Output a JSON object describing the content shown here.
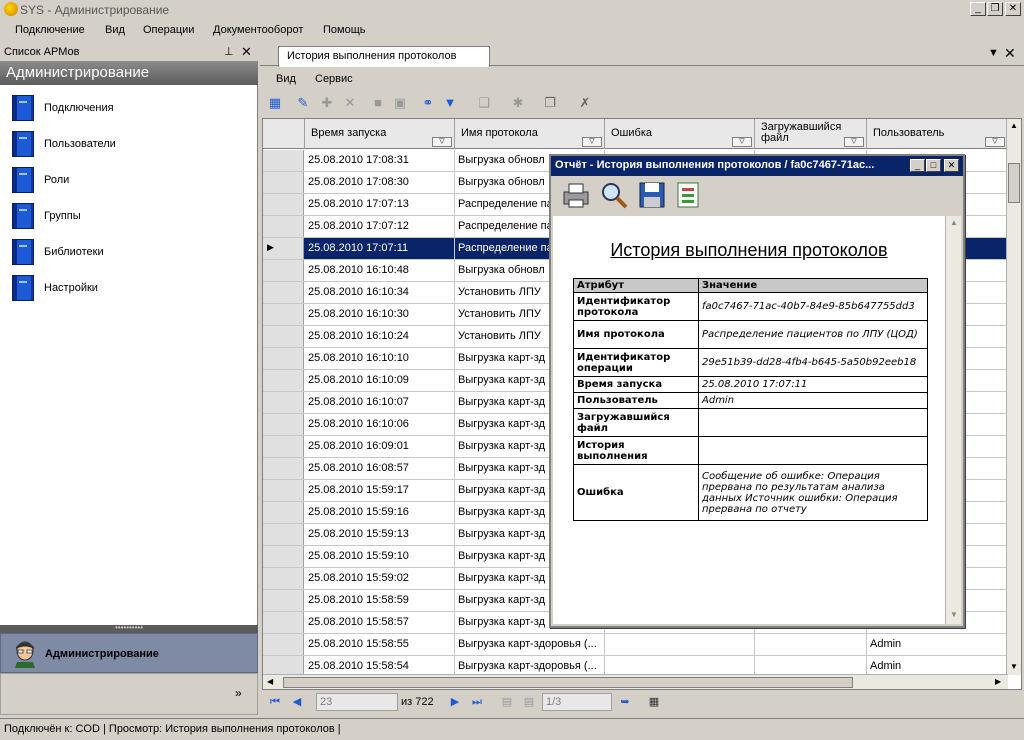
{
  "window": {
    "title": "SYS - Администрирование"
  },
  "menu": [
    "Подключение",
    "Вид",
    "Операции",
    "Документооборот",
    "Помощь"
  ],
  "left_panel": {
    "header": "Список АРМов",
    "band_title": "Администрирование",
    "items": [
      "Подключения",
      "Пользователи",
      "Роли",
      "Группы",
      "Библиотеки",
      "Настройки"
    ],
    "active_section": "Администрирование"
  },
  "tab": {
    "title": "История выполнения протоколов"
  },
  "doc_menu": [
    "Вид",
    "Сервис"
  ],
  "grid": {
    "columns": [
      "Время запуска",
      "Имя протокола",
      "Ошибка",
      "Загружавшийся файл",
      "Пользователь"
    ],
    "rows": [
      [
        "25.08.2010 17:08:31",
        "Выгрузка обновл",
        "",
        "",
        ""
      ],
      [
        "25.08.2010 17:08:30",
        "Выгрузка обновл",
        "",
        "",
        ""
      ],
      [
        "25.08.2010 17:07:13",
        "Распределение па",
        "",
        "",
        ""
      ],
      [
        "25.08.2010 17:07:12",
        "Распределение па",
        "",
        "",
        ""
      ],
      [
        "25.08.2010 17:07:11",
        "Распределение па",
        "",
        "",
        ""
      ],
      [
        "25.08.2010 16:10:48",
        "Выгрузка обновл",
        "",
        "",
        ""
      ],
      [
        "25.08.2010 16:10:34",
        "Установить ЛПУ",
        "",
        "",
        ""
      ],
      [
        "25.08.2010 16:10:30",
        "Установить ЛПУ",
        "",
        "",
        ""
      ],
      [
        "25.08.2010 16:10:24",
        "Установить ЛПУ",
        "",
        "",
        ""
      ],
      [
        "25.08.2010 16:10:10",
        "Выгрузка карт-зд",
        "",
        "",
        ""
      ],
      [
        "25.08.2010 16:10:09",
        "Выгрузка карт-зд",
        "",
        "",
        ""
      ],
      [
        "25.08.2010 16:10:07",
        "Выгрузка карт-зд",
        "",
        "",
        ""
      ],
      [
        "25.08.2010 16:10:06",
        "Выгрузка карт-зд",
        "",
        "",
        ""
      ],
      [
        "25.08.2010 16:09:01",
        "Выгрузка карт-зд",
        "",
        "",
        ""
      ],
      [
        "25.08.2010 16:08:57",
        "Выгрузка карт-зд",
        "",
        "",
        ""
      ],
      [
        "25.08.2010 15:59:17",
        "Выгрузка карт-зд",
        "",
        "",
        ""
      ],
      [
        "25.08.2010 15:59:16",
        "Выгрузка карт-зд",
        "",
        "",
        ""
      ],
      [
        "25.08.2010 15:59:13",
        "Выгрузка карт-зд",
        "",
        "",
        ""
      ],
      [
        "25.08.2010 15:59:10",
        "Выгрузка карт-зд",
        "",
        "",
        ""
      ],
      [
        "25.08.2010 15:59:02",
        "Выгрузка карт-зд",
        "",
        "",
        ""
      ],
      [
        "25.08.2010 15:58:59",
        "Выгрузка карт-зд",
        "",
        "",
        ""
      ],
      [
        "25.08.2010 15:58:57",
        "Выгрузка карт-зд",
        "",
        "",
        ""
      ],
      [
        "25.08.2010 15:58:55",
        "Выгрузка карт-здоровья (...",
        "",
        "",
        "Admin"
      ],
      [
        "25.08.2010 15:58:54",
        "Выгрузка карт-здоровья (...",
        "",
        "",
        "Admin"
      ]
    ],
    "selected_row": 4
  },
  "navigator": {
    "record": "23",
    "of_total": "из 722",
    "page": "1/3"
  },
  "status": {
    "connected": "Подключён к: COD",
    "view": "Просмотр: История выполнения протоколов"
  },
  "report": {
    "window_title": "Отчёт - История выполнения протоколов  /  fa0c7467-71ac...",
    "heading": "История выполнения протоколов",
    "table_headers": [
      "Атрибут",
      "Значение"
    ],
    "rows": [
      {
        "attr": "Идентификатор протокола",
        "value": "fa0c7467-71ac-40b7-84e9-85b647755dd3"
      },
      {
        "attr": "Имя протокола",
        "value": "Распределение пациентов по ЛПУ (ЦОД)"
      },
      {
        "attr": "Идентификатор операции",
        "value": "29e51b39-dd28-4fb4-b645-5a50b92eeb18"
      },
      {
        "attr": "Время запуска",
        "value": "25.08.2010 17:07:11"
      },
      {
        "attr": "Пользователь",
        "value": "Admin"
      },
      {
        "attr": "Загружавшийся файл",
        "value": ""
      },
      {
        "attr": "История выполнения",
        "value": ""
      },
      {
        "attr": "Ошибка",
        "value": "Сообщение об ошибке: Операция прервана по результатам анализа данных Источник ошибки: Операция прервана по отчету"
      }
    ]
  },
  "colors": {
    "selection": "#0a246a",
    "band": "#5b5b5b",
    "active_section": "#7f8aa5"
  }
}
